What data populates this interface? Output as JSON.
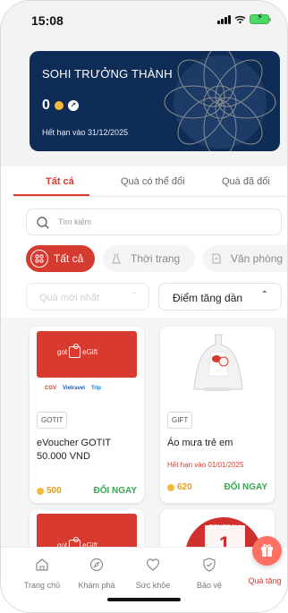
{
  "status_bar": {
    "time": "15:08"
  },
  "member_card": {
    "title": "SOHI TRƯỞNG THÀNH",
    "points": "0",
    "expiry": "Hết hạn vào 31/12/2025"
  },
  "tabs": [
    {
      "label": "Tất cả",
      "active": true
    },
    {
      "label": "Quà có thể đổi",
      "active": false
    },
    {
      "label": "Quà đã đổi",
      "active": false
    }
  ],
  "search": {
    "placeholder": "Tìm kiếm"
  },
  "categories": [
    {
      "label": "Tất cả",
      "active": true,
      "icon": "grid-icon"
    },
    {
      "label": "Thời trang",
      "active": false,
      "icon": "dress-icon"
    },
    {
      "label": "Văn phòng",
      "active": false,
      "icon": "paper-icon"
    }
  ],
  "filters": {
    "sort_left": "Quà mới nhất",
    "sort_right": "Điểm tăng dần"
  },
  "products": [
    {
      "logo_text_left": "got",
      "logo_text_right": "eGift",
      "brands": [
        "CGV",
        "Vietravel",
        "Trip"
      ],
      "tag": "GOTIT",
      "name": "eVoucher GOTIT 50.000 VND",
      "price": "500",
      "redeem_label": "ĐỔI NGAY"
    },
    {
      "tag": "GIFT",
      "name": "Áo mưa trẻ em",
      "expiry": "Hết hạn vào 01/01/2025",
      "price": "620",
      "redeem_label": "ĐỔI NGAY"
    },
    {
      "logo_text_left": "got",
      "logo_text_right": "eGift"
    },
    {
      "badge_text": "GENERALI",
      "number": "1"
    }
  ],
  "bottom_nav": [
    {
      "label": "Trang chủ",
      "icon": "home-icon"
    },
    {
      "label": "Khám phá",
      "icon": "compass-icon"
    },
    {
      "label": "Sức khỏe",
      "icon": "heart-icon"
    },
    {
      "label": "Bảo vệ",
      "icon": "shield-icon"
    },
    {
      "label": "Quà tặng",
      "icon": "gift-icon",
      "active": true
    }
  ],
  "colors": {
    "accent": "#d63b30",
    "navy": "#0f2c56",
    "coin": "#f4b938",
    "redeem": "#39a653"
  }
}
